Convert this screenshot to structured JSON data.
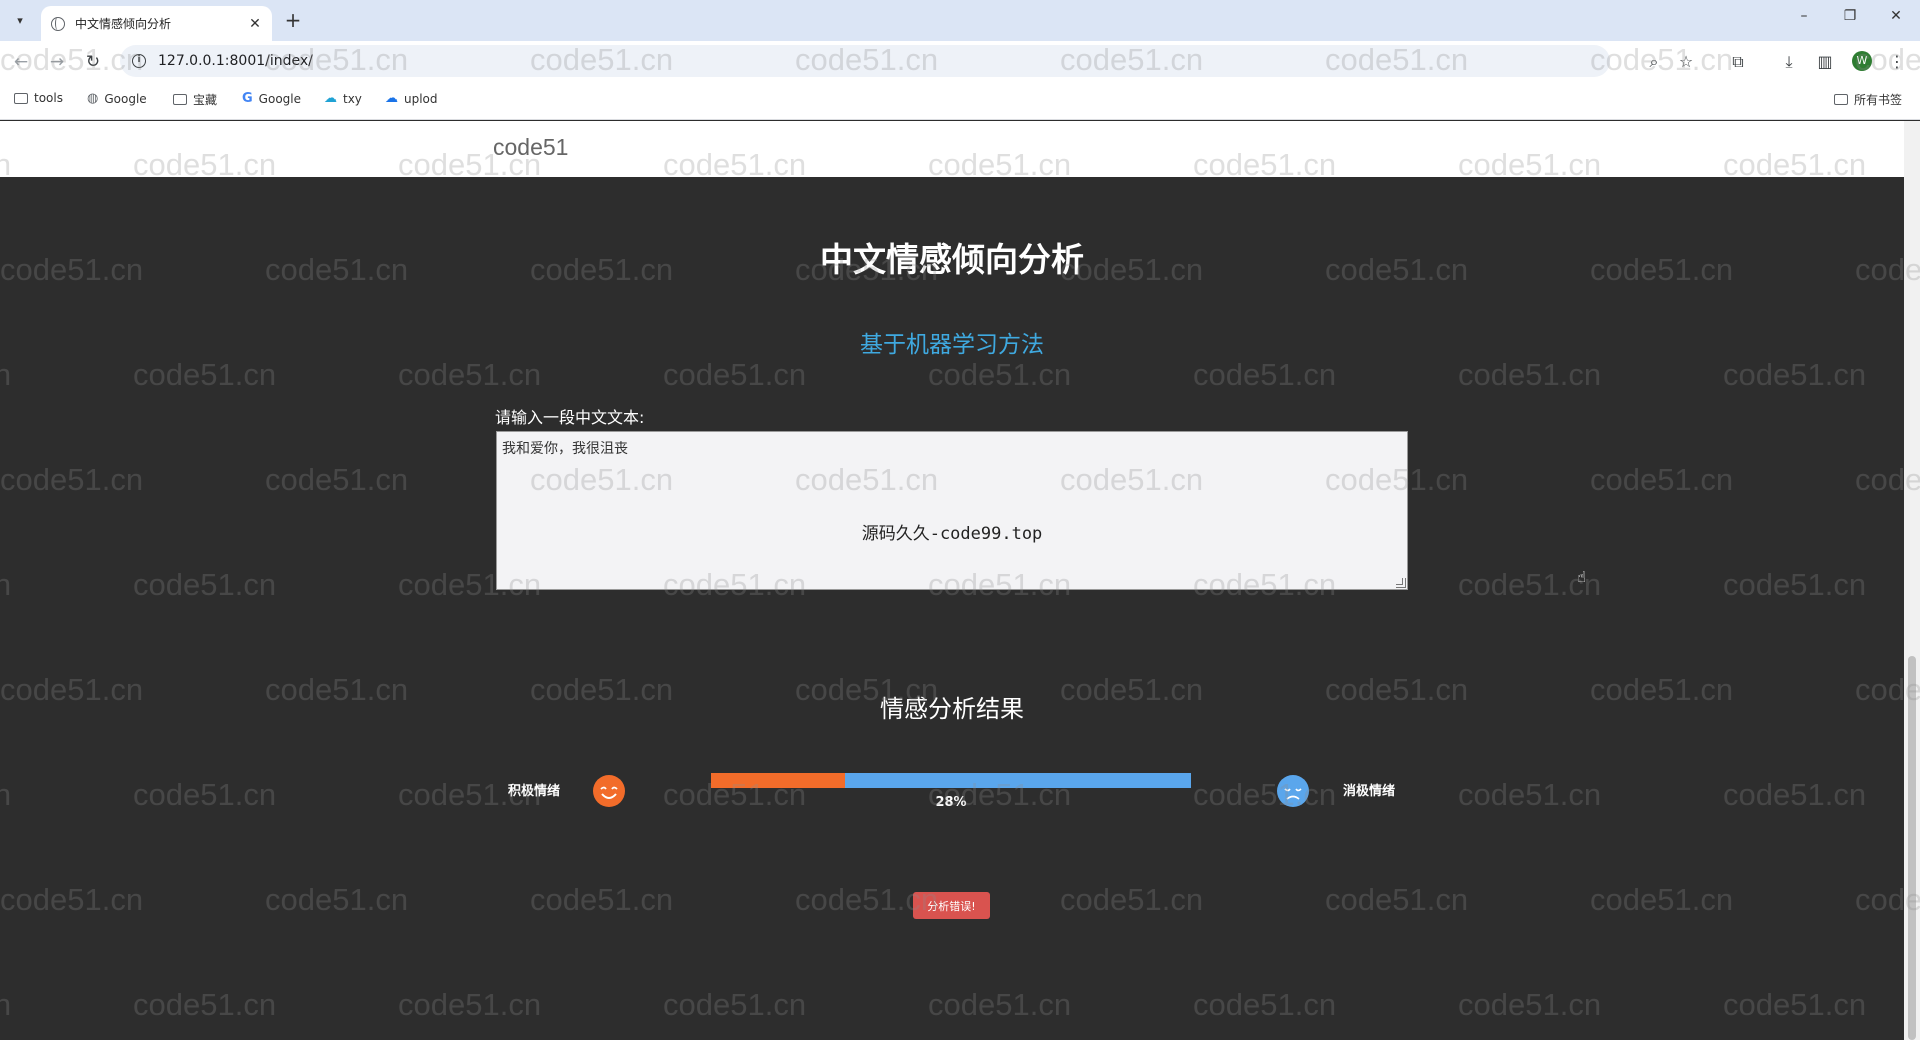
{
  "browser": {
    "tab_title": "中文情感倾向分析",
    "tab_close": "✕",
    "new_tab": "+",
    "url": "127.0.0.1:8001/index/",
    "profile_initial": "W",
    "bookmarks": [
      {
        "label": "tools",
        "icon": "folder-icon"
      },
      {
        "label": "Google",
        "icon": "globe-icon"
      },
      {
        "label": "宝藏",
        "icon": "folder-icon"
      },
      {
        "label": "Google",
        "icon": "google-icon"
      },
      {
        "label": "txy",
        "icon": "cloud-icon"
      },
      {
        "label": "uplod",
        "icon": "cloud-icon"
      }
    ],
    "all_bookmarks": "所有书签"
  },
  "site": {
    "brand": "code51"
  },
  "hero": {
    "title": "中文情感倾向分析",
    "subtitle": "基于机器学习方法"
  },
  "input": {
    "label": "请输入一段中文文本:",
    "value": "我和爱你，我很沮丧",
    "overlay_watermark": "源码久久-code99.top"
  },
  "result": {
    "title": "情感分析结果",
    "positive_label": "积极情绪",
    "negative_label": "消极情绪",
    "positive_percent": 28,
    "percent_text": "28%",
    "positive_color": "#f26c2a",
    "negative_color": "#5aa6ec",
    "error_button": "分析错误!"
  },
  "watermark_text": "code51.cn"
}
